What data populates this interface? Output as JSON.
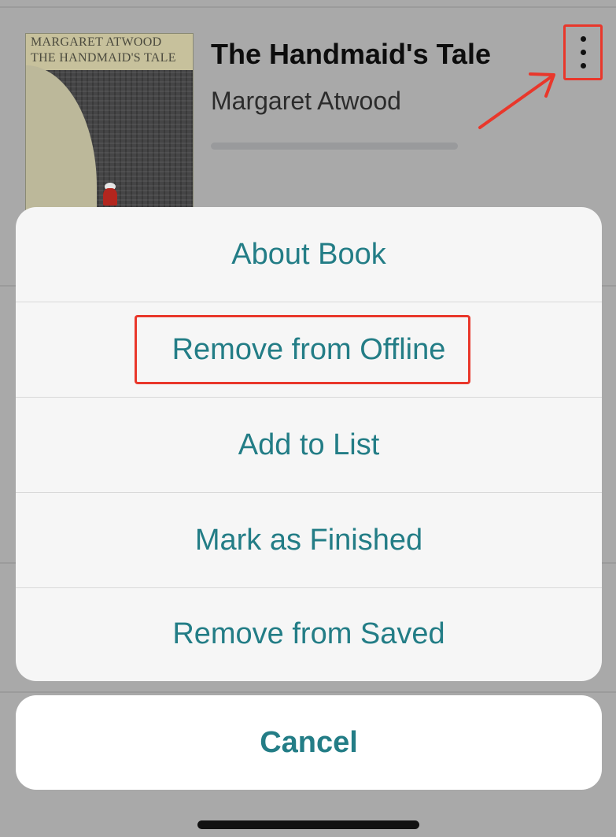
{
  "book": {
    "cover_line_1": "MARGARET ATWOOD",
    "cover_line_2": "THE HANDMAID'S TALE",
    "title": "The Handmaid's Tale",
    "author": "Margaret Atwood",
    "progress_fraction": 0.0
  },
  "more_button": {
    "icon": "more-vertical-icon"
  },
  "action_sheet": {
    "items": [
      {
        "label": "About Book"
      },
      {
        "label": "Remove from Offline"
      },
      {
        "label": "Add to List"
      },
      {
        "label": "Mark as Finished"
      },
      {
        "label": "Remove from Saved"
      }
    ],
    "cancel_label": "Cancel"
  },
  "colors": {
    "accent": "#237d86",
    "annotation": "#e9372b",
    "dim_background": "#a9a9a9"
  }
}
